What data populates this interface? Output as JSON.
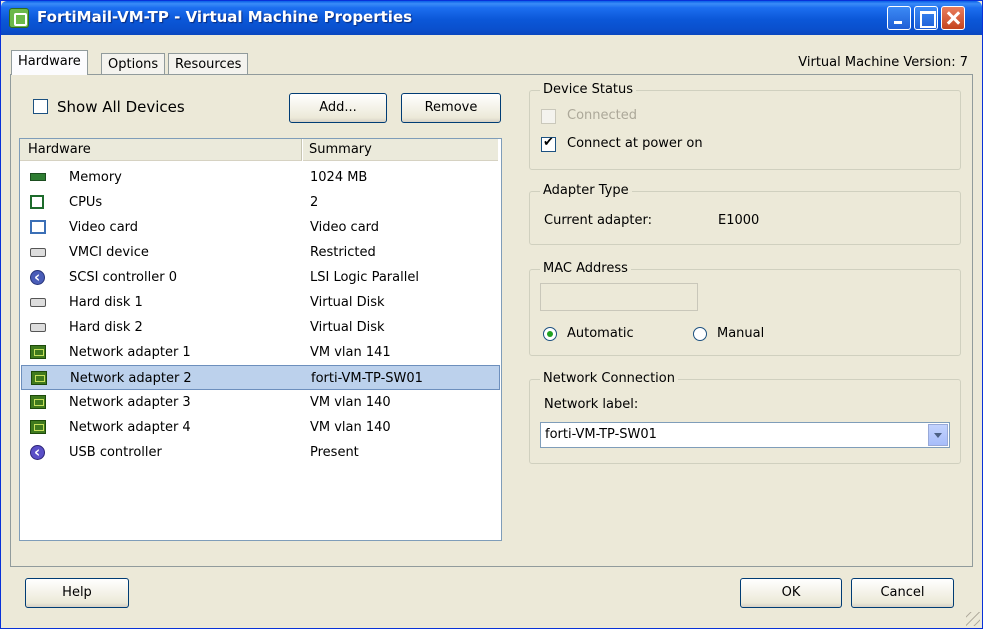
{
  "window": {
    "title": "FortiMail-VM-TP - Virtual Machine Properties",
    "version_label": "Virtual Machine Version: 7"
  },
  "tabs": [
    {
      "label": "Hardware",
      "active": true
    },
    {
      "label": "Options",
      "active": false
    },
    {
      "label": "Resources",
      "active": false
    }
  ],
  "left": {
    "show_all_devices_label": "Show All Devices",
    "show_all_devices_checked": false,
    "add_label": "Add...",
    "remove_label": "Remove",
    "columns": [
      "Hardware",
      "Summary"
    ],
    "rows": [
      {
        "icon": "memory-icon",
        "name": "Memory",
        "summary": "1024 MB"
      },
      {
        "icon": "cpu-icon",
        "name": "CPUs",
        "summary": "2"
      },
      {
        "icon": "video-card-icon",
        "name": "Video card",
        "summary": "Video card"
      },
      {
        "icon": "vmci-device-icon",
        "name": "VMCI device",
        "summary": "Restricted"
      },
      {
        "icon": "scsi-controller-icon",
        "name": "SCSI controller 0",
        "summary": "LSI Logic Parallel"
      },
      {
        "icon": "hard-disk-icon",
        "name": "Hard disk 1",
        "summary": "Virtual Disk"
      },
      {
        "icon": "hard-disk-icon",
        "name": "Hard disk 2",
        "summary": "Virtual Disk"
      },
      {
        "icon": "network-adapter-icon",
        "name": "Network adapter 1",
        "summary": "VM vlan 141"
      },
      {
        "icon": "network-adapter-icon",
        "name": "Network adapter 2",
        "summary": "forti-VM-TP-SW01",
        "selected": true
      },
      {
        "icon": "network-adapter-icon",
        "name": "Network adapter 3",
        "summary": "VM vlan 140"
      },
      {
        "icon": "network-adapter-icon",
        "name": "Network adapter 4",
        "summary": "VM vlan 140"
      },
      {
        "icon": "usb-controller-icon",
        "name": "USB controller",
        "summary": "Present"
      }
    ]
  },
  "device_status": {
    "title": "Device Status",
    "connected_label": "Connected",
    "connected_checked": false,
    "connected_disabled": true,
    "connect_power_on_label": "Connect at power on",
    "connect_power_on_checked": true
  },
  "adapter_type": {
    "title": "Adapter Type",
    "current_label": "Current adapter:",
    "current_value": "E1000"
  },
  "mac_address": {
    "title": "MAC Address",
    "value": "",
    "automatic_label": "Automatic",
    "manual_label": "Manual",
    "selected": "Automatic"
  },
  "network_connection": {
    "title": "Network Connection",
    "label": "Network label:",
    "selected_value": "forti-VM-TP-SW01"
  },
  "footer": {
    "help_label": "Help",
    "ok_label": "OK",
    "cancel_label": "Cancel"
  }
}
